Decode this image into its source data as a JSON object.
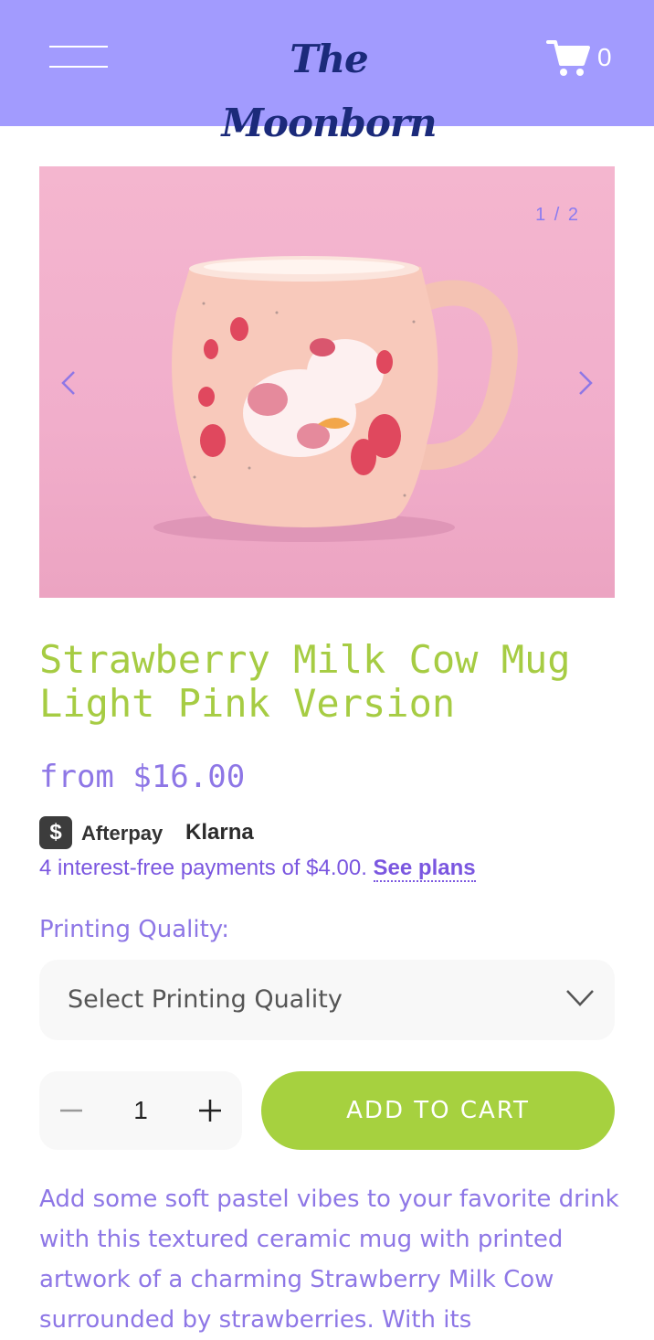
{
  "header": {
    "logo_text": "The Moonborn",
    "cart_count": "0",
    "background_color": "#a29bfe"
  },
  "gallery": {
    "counter": "1 / 2"
  },
  "product": {
    "title": "Strawberry Milk Cow Mug Light Pink Version",
    "price_text": "from $16.00"
  },
  "payments": {
    "afterpay_icon_glyph": "$",
    "afterpay_label": "Afterpay",
    "klarna_label": "Klarna",
    "installment_text": "4 interest-free payments of $4.00.",
    "see_plans_label": "See plans"
  },
  "option": {
    "label": "Printing Quality:",
    "selected_value": "Select Printing Quality"
  },
  "purchase": {
    "quantity": "1",
    "add_to_cart_label": "ADD TO CART",
    "accent_color": "#a6d13f"
  },
  "description": {
    "text": "Add some soft pastel vibes to your favorite drink with this textured ceramic mug with printed artwork of a charming Strawberry Milk Cow surrounded by strawberries. With its"
  },
  "icons": {
    "menu": "hamburger-menu-icon",
    "cart": "cart-icon",
    "prev": "chevron-left-icon",
    "next": "chevron-right-icon",
    "dropdown": "chevron-down-icon",
    "minus": "minus-icon",
    "plus": "plus-icon"
  }
}
